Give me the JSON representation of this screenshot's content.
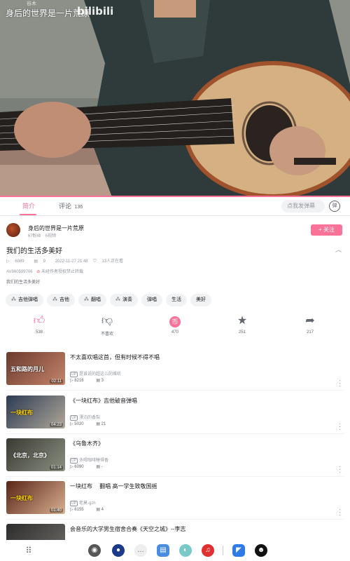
{
  "video": {
    "title": "身后的世界是一片荒原",
    "watermark": "bilibili",
    "small_text": "谷木"
  },
  "tabs": {
    "intro_label": "简介",
    "comments_label": "评论",
    "comments_count": "136",
    "danmaku_placeholder": "点我发弹幕"
  },
  "uploader": {
    "name": "身后的世界是一片荒原",
    "stats": "67粉丝　6视频",
    "follow_label": "+ 关注"
  },
  "main": {
    "title": "我们的生活多美好",
    "views": "6089",
    "danmaku": "9",
    "date": "2022-11-27 21:48",
    "watching": "13人正在看",
    "av": "AV860599706",
    "ban_notice": "未经作者授权禁止转载",
    "description": "我们的生活多美好"
  },
  "tags": [
    "吉他弹唱",
    "吉他",
    "翻唱",
    "演奏",
    "弹唱",
    "生活",
    "美好"
  ],
  "actions": [
    {
      "icon": "like-icon",
      "label": "538"
    },
    {
      "icon": "dislike-icon",
      "label": "不喜欢"
    },
    {
      "icon": "coin-icon",
      "label": "470"
    },
    {
      "icon": "favorite-icon",
      "label": "251"
    },
    {
      "icon": "share-icon",
      "label": "217"
    }
  ],
  "recommended": [
    {
      "title": "不太喜欢唱这首，但有时候不得不唱",
      "up": "是谁说的超这么的难听",
      "views": "8216",
      "danmaku": "3",
      "duration": "02:11",
      "overlay": "五和路的月儿",
      "colors": [
        "#6b3a2e",
        "#c4846a"
      ]
    },
    {
      "title": "《一块红布》吉他破音弹唱",
      "up": "漂泊的香梨",
      "views": "5020",
      "danmaku": "21",
      "duration": "04:23",
      "overlay": "一块红布",
      "colors": [
        "#2b3a52",
        "#b0a79a"
      ]
    },
    {
      "title": "《乌鲁木齐》",
      "up": "多喝咖啡睡得香",
      "views": "6090",
      "danmaku": "-",
      "duration": "01:14",
      "overlay": "《北京，北京》",
      "colors": [
        "#3a3a34",
        "#8a8f80"
      ]
    },
    {
      "title": "一块红布　 翻唱 高一学生致敬国摇",
      "up": "老莫-gzh",
      "views": "6155",
      "danmaku": "4",
      "duration": "01:40",
      "overlay": "一块红布",
      "colors": [
        "#5a2418",
        "#d8b090"
      ]
    },
    {
      "title": "会音乐的大学男生宿舍合奏《天空之城》--李志",
      "up": "",
      "views": "",
      "danmaku": "",
      "duration": "",
      "overlay": "",
      "colors": [
        "#2d2d2d",
        "#6d6a66"
      ]
    }
  ],
  "taskbar_icons": [
    "apps-icon",
    "camera-icon",
    "browser-icon",
    "messages-icon",
    "files-icon",
    "weather-icon",
    "netease-music-icon",
    "feishu-icon",
    "qq-icon"
  ]
}
